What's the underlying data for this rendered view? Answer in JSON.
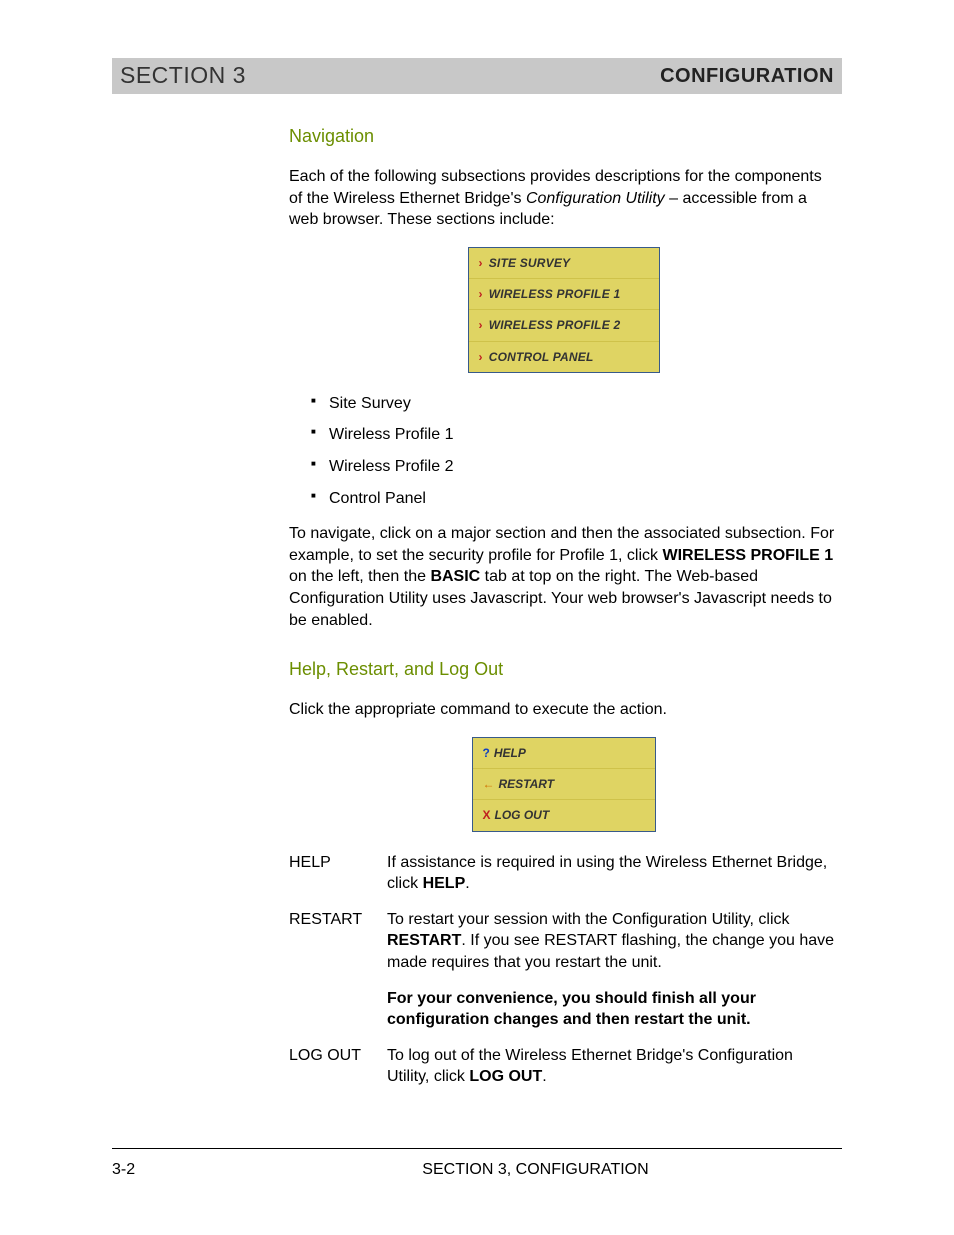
{
  "header": {
    "left": "SECTION 3",
    "right": "CONFIGURATION"
  },
  "nav": {
    "heading": "Navigation",
    "intro_pre": "Each of the following subsections provides descriptions for the components of the Wireless Ethernet Bridge's ",
    "intro_em": "Configuration Utility",
    "intro_post": " – accessible from a web browser. These sections include:",
    "menu": [
      "SITE SURVEY",
      "WIRELESS PROFILE 1",
      "WIRELESS PROFILE 2",
      "CONTROL PANEL"
    ],
    "bullets": [
      "Site Survey",
      "Wireless Profile 1",
      "Wireless Profile 2",
      "Control Panel"
    ],
    "para2_a": "To navigate, click on a major section and then the associated subsection. For example, to set the security profile for Profile 1, click ",
    "para2_b1": "WIRELESS PROFILE 1",
    "para2_c": " on the left, then the ",
    "para2_b2": "BASIC",
    "para2_d": " tab at top on the right. The Web-based Configuration Utility uses Javascript. Your web browser's Javascript needs to be enabled."
  },
  "hrl": {
    "heading": "Help, Restart, and Log Out",
    "intro": "Click the appropriate command to execute the action.",
    "actions": [
      {
        "sym": "?",
        "sym_class": "c-blue",
        "label": "HELP"
      },
      {
        "sym": "←",
        "sym_class": "c-orange",
        "label": "RESTART"
      },
      {
        "sym": "X",
        "sym_class": "c-red",
        "label": "LOG OUT"
      }
    ],
    "defs": {
      "help": {
        "term": "HELP",
        "pre": "If assistance is required in using the Wireless Ethernet Bridge, click ",
        "bold": "HELP",
        "post": "."
      },
      "restart": {
        "term": "RESTART",
        "pre": "To restart your session with the Configuration Utility, click ",
        "bold": "RESTART",
        "post": ". If you see RESTART flashing, the change you have made requires that you restart the unit.",
        "note": "For your convenience, you should finish all your configuration changes and then restart the unit."
      },
      "logout": {
        "term": "LOG OUT",
        "pre": "To log out of the Wireless Ethernet Bridge's Configuration Utility, click ",
        "bold": "LOG OUT",
        "post": "."
      }
    }
  },
  "footer": {
    "page": "3-2",
    "center": "SECTION 3, CONFIGURATION"
  }
}
